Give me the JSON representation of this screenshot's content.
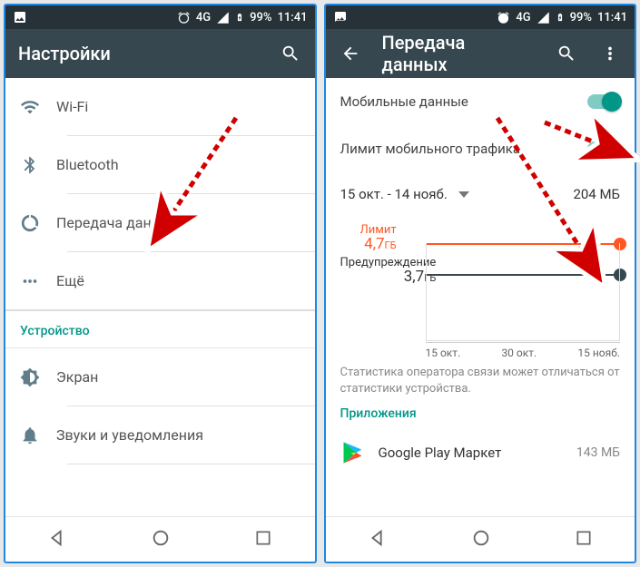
{
  "status": {
    "time": "11:41",
    "battery": "99%",
    "net": "4G"
  },
  "left": {
    "appbar_title": "Настройки",
    "items": [
      {
        "label": "Wi-Fi"
      },
      {
        "label": "Bluetooth"
      },
      {
        "label": "Передача данных"
      },
      {
        "label": "Ещё"
      }
    ],
    "section_device": "Устройство",
    "device_items": [
      {
        "label": "Экран"
      },
      {
        "label": "Звуки и уведомления"
      }
    ]
  },
  "right": {
    "appbar_title": "Передача данных",
    "mobile_data_label": "Мобильные данные",
    "limit_label": "Лимит мобильного трафика",
    "period": "15 окт. - 14 нояб.",
    "usage_total": "204 МБ",
    "limit_name": "Лимит",
    "limit_value": "4,7",
    "limit_unit": "ГБ",
    "warn_name": "Предупреждение",
    "warn_value": "3,7",
    "warn_unit": "ГБ",
    "axis": {
      "a": "15 окт.",
      "b": "30 окт.",
      "c": "15 нояб."
    },
    "disclaimer": "Статистика оператора связи может отличаться от статистики устройства.",
    "apps_head": "Приложения",
    "app1_name": "Google Play Маркет",
    "app1_size": "143 МБ"
  },
  "chart_data": {
    "type": "line",
    "title": "Передача данных",
    "x_range": [
      "15 окт.",
      "14 нояб."
    ],
    "x_ticks": [
      "15 окт.",
      "30 окт.",
      "15 нояб."
    ],
    "y_unit": "ГБ",
    "thresholds": [
      {
        "name": "Лимит",
        "value_gb": 4.7,
        "color": "#ff5722"
      },
      {
        "name": "Предупреждение",
        "value_gb": 3.7,
        "color": "#37474f"
      }
    ],
    "usage_total_mb": 204
  }
}
